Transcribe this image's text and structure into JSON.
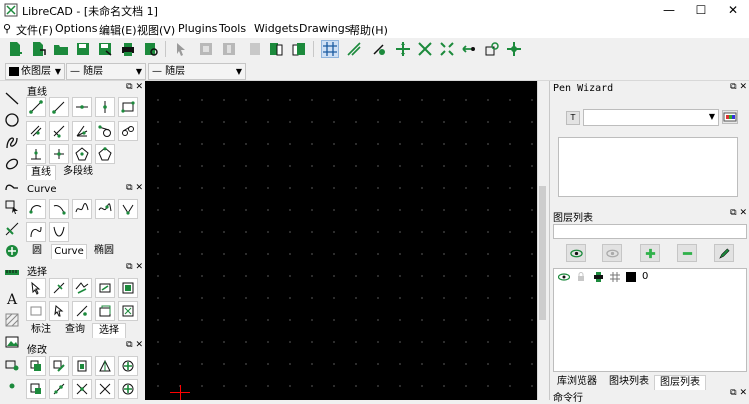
{
  "window": {
    "title": "LibreCAD - [未命名文档 1]",
    "minimize": "—",
    "maximize": "☐",
    "close": "✕"
  },
  "menu": [
    "文件(F)",
    "Options",
    "编辑(E)",
    "视图(V)",
    "Plugins",
    "Tools",
    "Widgets",
    "Drawings",
    "帮助(H)"
  ],
  "pen": {
    "color_label": "依图层",
    "line_type": "— 随层",
    "line_width": "— 随层"
  },
  "left_dock": {
    "line_panel": {
      "title": "直线",
      "tabs": [
        "直线",
        "多段线"
      ]
    },
    "curve_panel": {
      "title": "Curve",
      "tabs": [
        "圆",
        "Curve",
        "椭圆"
      ]
    },
    "select_panel": {
      "title": "选择",
      "tabs": [
        "标注",
        "查询",
        "选择"
      ]
    },
    "modify_panel": {
      "title": "修改"
    },
    "dock_buttons": "⧉ ✕"
  },
  "right_dock": {
    "pen_wizard": {
      "title": "Pen Wizard"
    },
    "layer_list": {
      "title": "图层列表",
      "layer_name": "0"
    },
    "bottom_tabs": [
      "库浏览器",
      "图块列表",
      "图层列表"
    ],
    "command_line": {
      "title": "命令行"
    },
    "dock_buttons": "⧉ ✕"
  },
  "colors": {
    "accent": "#1c8a3c",
    "canvas": "#000000",
    "crosshair": "#ff0000"
  }
}
